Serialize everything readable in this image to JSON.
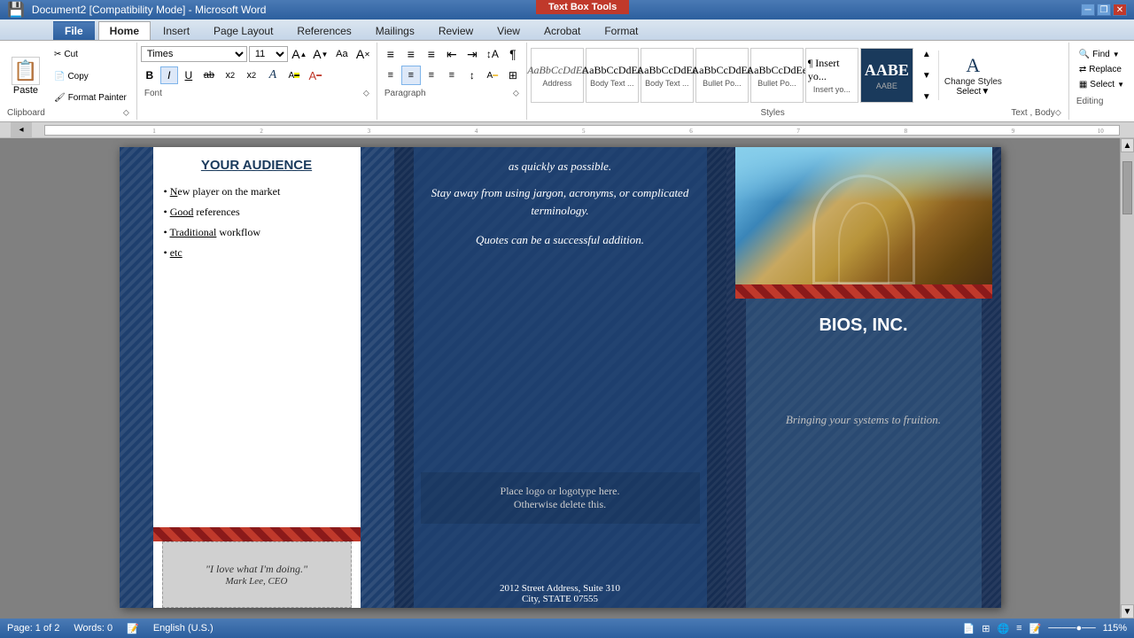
{
  "titlebar": {
    "title": "Document2 [Compatibility Mode] - Microsoft Word",
    "controls": [
      "minimize",
      "restore",
      "close"
    ]
  },
  "textboxtoolstab": {
    "label": "Text Box Tools"
  },
  "tabs": [
    {
      "label": "File",
      "active": false
    },
    {
      "label": "Home",
      "active": true
    },
    {
      "label": "Insert",
      "active": false
    },
    {
      "label": "Page Layout",
      "active": false
    },
    {
      "label": "References",
      "active": false
    },
    {
      "label": "Mailings",
      "active": false
    },
    {
      "label": "Review",
      "active": false
    },
    {
      "label": "View",
      "active": false
    },
    {
      "label": "Acrobat",
      "active": false
    },
    {
      "label": "Format",
      "active": false
    }
  ],
  "clipboard": {
    "paste_label": "Paste",
    "cut_label": "Cut",
    "copy_label": "Copy",
    "format_painter_label": "Format Painter",
    "group_label": "Clipboard"
  },
  "font": {
    "name": "Times",
    "size": "11",
    "group_label": "Font"
  },
  "paragraph": {
    "group_label": "Paragraph"
  },
  "styles": {
    "group_label": "Styles",
    "items": [
      {
        "label": "Address",
        "preview": "Address"
      },
      {
        "label": "Body Text ...",
        "preview": "Body Text..."
      },
      {
        "label": "Body Text ...",
        "preview": "Body Text..."
      },
      {
        "label": "Bullet Po...",
        "preview": "Bullet Po..."
      },
      {
        "label": "Bullet Po...",
        "preview": "Bullet Po..."
      },
      {
        "label": "Insert yo...",
        "preview": "Aa"
      },
      {
        "label": "AABE",
        "preview": "AABE"
      }
    ],
    "change_styles_label": "Change Styles",
    "select_label": "Select",
    "text_body_label": "Text , Body"
  },
  "editing": {
    "find_label": "Find",
    "replace_label": "Replace",
    "select_label": "Select",
    "group_label": "Editing"
  },
  "document": {
    "panel1": {
      "title": "YOUR AUDIENCE",
      "bullets": [
        "New player on the market",
        "Good references",
        "Traditional workflow",
        "etc"
      ],
      "quote": "\"I love what I'm doing.\"",
      "quote_author": "Mark Lee, CEO"
    },
    "panel2": {
      "text1": "as quickly as possible.",
      "text2": "Stay away from using jargon, acronyms, or complicated terminology.",
      "text3": "Quotes can be a successful addition.",
      "logo_text": "Place logo  or logotype here.",
      "logo_text2": "Otherwise delete this.",
      "address1": "2012 Street Address,  Suite 310",
      "address2": "City, STATE 07555"
    },
    "panel3": {
      "company_name": "BIOS, INC.",
      "tagline": "Bringing your systems to fruition."
    }
  },
  "statusbar": {
    "page": "Page: 1 of 2",
    "words": "Words: 0",
    "language": "English (U.S.)",
    "zoom": "115%"
  }
}
